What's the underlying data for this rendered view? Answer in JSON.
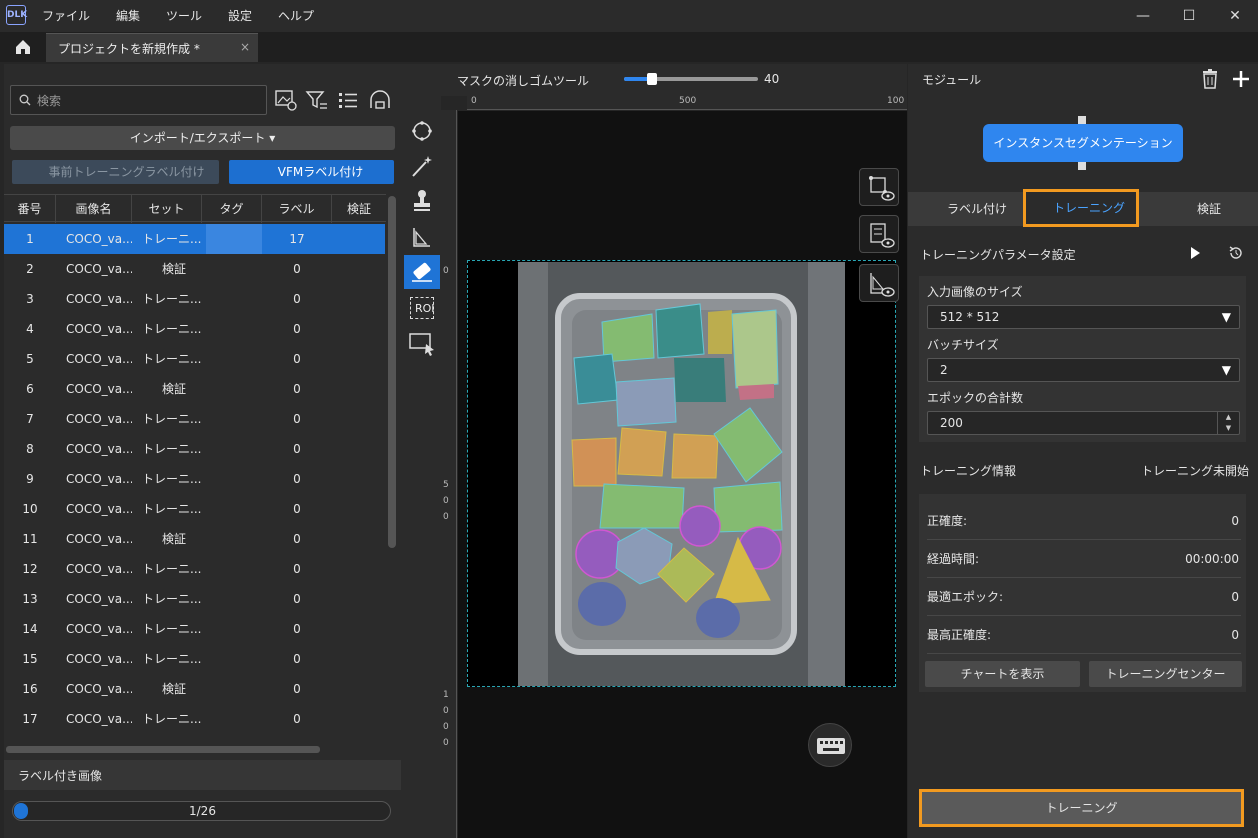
{
  "menu": {
    "logo": "DLK",
    "items": [
      "ファイル",
      "編集",
      "ツール",
      "設定",
      "ヘルプ"
    ],
    "window_controls": [
      "—",
      "☐",
      "✕"
    ]
  },
  "tabs": {
    "project": "プロジェクトを新規作成 *",
    "close": "×"
  },
  "left": {
    "search_placeholder": "検索",
    "import_export": "インポート/エクスポート ▾",
    "pretrain_label": "事前トレーニングラベル付け",
    "vfm_label": "VFMラベル付け",
    "columns": [
      "番号",
      "画像名",
      "セット",
      "タグ",
      "ラベル",
      "検証"
    ],
    "rows": [
      {
        "no": "1",
        "name": "COCO_va...",
        "set": "トレーニ...",
        "label": "17"
      },
      {
        "no": "2",
        "name": "COCO_va...",
        "set": "検証",
        "label": "0"
      },
      {
        "no": "3",
        "name": "COCO_va...",
        "set": "トレーニ...",
        "label": "0"
      },
      {
        "no": "4",
        "name": "COCO_va...",
        "set": "トレーニ...",
        "label": "0"
      },
      {
        "no": "5",
        "name": "COCO_va...",
        "set": "トレーニ...",
        "label": "0"
      },
      {
        "no": "6",
        "name": "COCO_va...",
        "set": "検証",
        "label": "0"
      },
      {
        "no": "7",
        "name": "COCO_va...",
        "set": "トレーニ...",
        "label": "0"
      },
      {
        "no": "8",
        "name": "COCO_va...",
        "set": "トレーニ...",
        "label": "0"
      },
      {
        "no": "9",
        "name": "COCO_va...",
        "set": "トレーニ...",
        "label": "0"
      },
      {
        "no": "10",
        "name": "COCO_va...",
        "set": "トレーニ...",
        "label": "0"
      },
      {
        "no": "11",
        "name": "COCO_va...",
        "set": "検証",
        "label": "0"
      },
      {
        "no": "12",
        "name": "COCO_va...",
        "set": "トレーニ...",
        "label": "0"
      },
      {
        "no": "13",
        "name": "COCO_va...",
        "set": "トレーニ...",
        "label": "0"
      },
      {
        "no": "14",
        "name": "COCO_va...",
        "set": "トレーニ...",
        "label": "0"
      },
      {
        "no": "15",
        "name": "COCO_va...",
        "set": "トレーニ...",
        "label": "0"
      },
      {
        "no": "16",
        "name": "COCO_va...",
        "set": "検証",
        "label": "0"
      },
      {
        "no": "17",
        "name": "COCO_va...",
        "set": "トレーニ...",
        "label": "0"
      }
    ],
    "labeled_title": "ラベル付き画像",
    "progress_text": "1/26",
    "progress_fraction": 0.038
  },
  "tools": {
    "roi_label": "ROI"
  },
  "canvas": {
    "tool_name": "マスクの消しゴムツール",
    "brush_size": "40",
    "brush_fraction": 0.21,
    "ruler_h": [
      "0",
      "500",
      "100"
    ],
    "ruler_v_digits": [
      "0",
      "5",
      "0",
      "0",
      "1",
      "0",
      "0",
      "0"
    ]
  },
  "right": {
    "module_title": "モジュール",
    "module_node": "インスタンスセグメンテーション",
    "tabs": [
      "ラベル付け",
      "トレーニング",
      "検証"
    ],
    "params_title": "トレーニングパラメータ設定",
    "input_size_label": "入力画像のサイズ",
    "input_size_value": "512 * 512",
    "batch_label": "バッチサイズ",
    "batch_value": "2",
    "epoch_label": "エポックの合計数",
    "epoch_value": "200",
    "info_title": "トレーニング情報",
    "info_status": "トレーニング未開始",
    "metrics": [
      {
        "label": "正確度:",
        "value": "0"
      },
      {
        "label": "経過時間:",
        "value": "00:00:00"
      },
      {
        "label": "最適エポック:",
        "value": "0"
      },
      {
        "label": "最高正確度:",
        "value": "0"
      }
    ],
    "show_chart": "チャートを表示",
    "training_center": "トレーニングセンター",
    "train_button": "トレーニング"
  },
  "colors": {
    "accent_blue": "#1f74d6",
    "highlight_orange": "#f29a20",
    "mask_cyan": "#29a7b5"
  }
}
